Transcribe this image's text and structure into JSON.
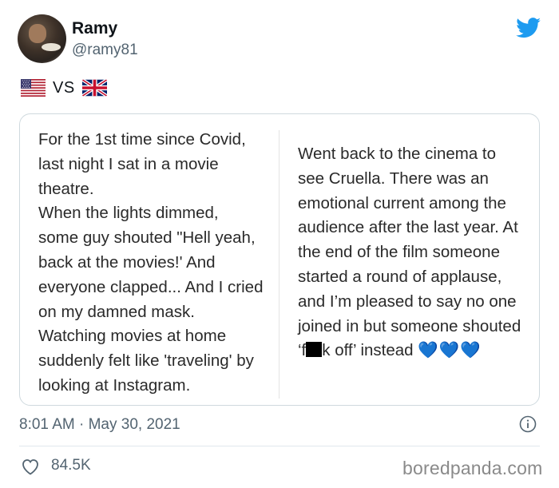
{
  "tweet": {
    "author": {
      "name": "Ramy",
      "handle": "@ramy81"
    },
    "flags_text": "VS",
    "flags": {
      "left": "us-flag-icon",
      "right": "uk-flag-icon"
    },
    "image": {
      "left_text": "For the 1st time since Covid,\nlast night I sat in a movie\ntheatre.\nWhen the lights dimmed,\nsome guy shouted \"Hell yeah,\nback at the movies!' And\neveryone clapped... And I cried\non my damned mask.\nWatching movies at home\nsuddenly felt like 'traveling' by\nlooking at Instagram.",
      "right_text_before_censor": "Went back to the cinema to\nsee Cruella. There was an\nemotional current among the\naudience after the last year. At\nthe end of the film someone\nstarted a round of applause,\nand I’m pleased to say no one\njoined in but someone shouted\n‘f",
      "right_text_after_censor": "k off’ instead ",
      "right_emoji": "💙💙💙"
    },
    "timestamp": "8:01 AM · May 30, 2021",
    "likes": "84.5K"
  },
  "watermark": "boredpanda.com",
  "colors": {
    "twitter_blue": "#1d9bf0",
    "secondary_text": "#536471",
    "heart_emoji": "#1d8fe0"
  }
}
